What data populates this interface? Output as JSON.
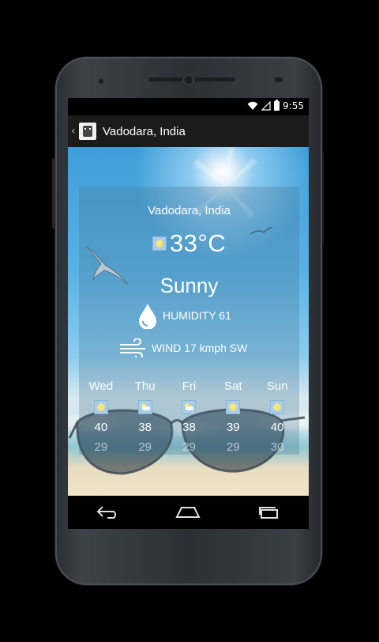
{
  "status_bar": {
    "time": "9:55"
  },
  "action_bar": {
    "title": "Vadodara, India"
  },
  "weather": {
    "location": "Vadodara, India",
    "temperature": "33°C",
    "condition": "Sunny",
    "humidity": "HUMIDITY 61",
    "wind": "WIND 17 kmph SW"
  },
  "forecast": [
    {
      "day": "Wed",
      "icon": "sunny-icon",
      "high": "40",
      "low": "29"
    },
    {
      "day": "Thu",
      "icon": "partly-cloudy-icon",
      "high": "38",
      "low": "29"
    },
    {
      "day": "Fri",
      "icon": "partly-cloudy-icon",
      "high": "38",
      "low": "29"
    },
    {
      "day": "Sat",
      "icon": "sunny-icon",
      "high": "39",
      "low": "29"
    },
    {
      "day": "Sun",
      "icon": "sunny-icon",
      "high": "40",
      "low": "30"
    }
  ],
  "nav": {
    "back": "back-icon",
    "home": "home-icon",
    "recents": "recents-icon"
  }
}
